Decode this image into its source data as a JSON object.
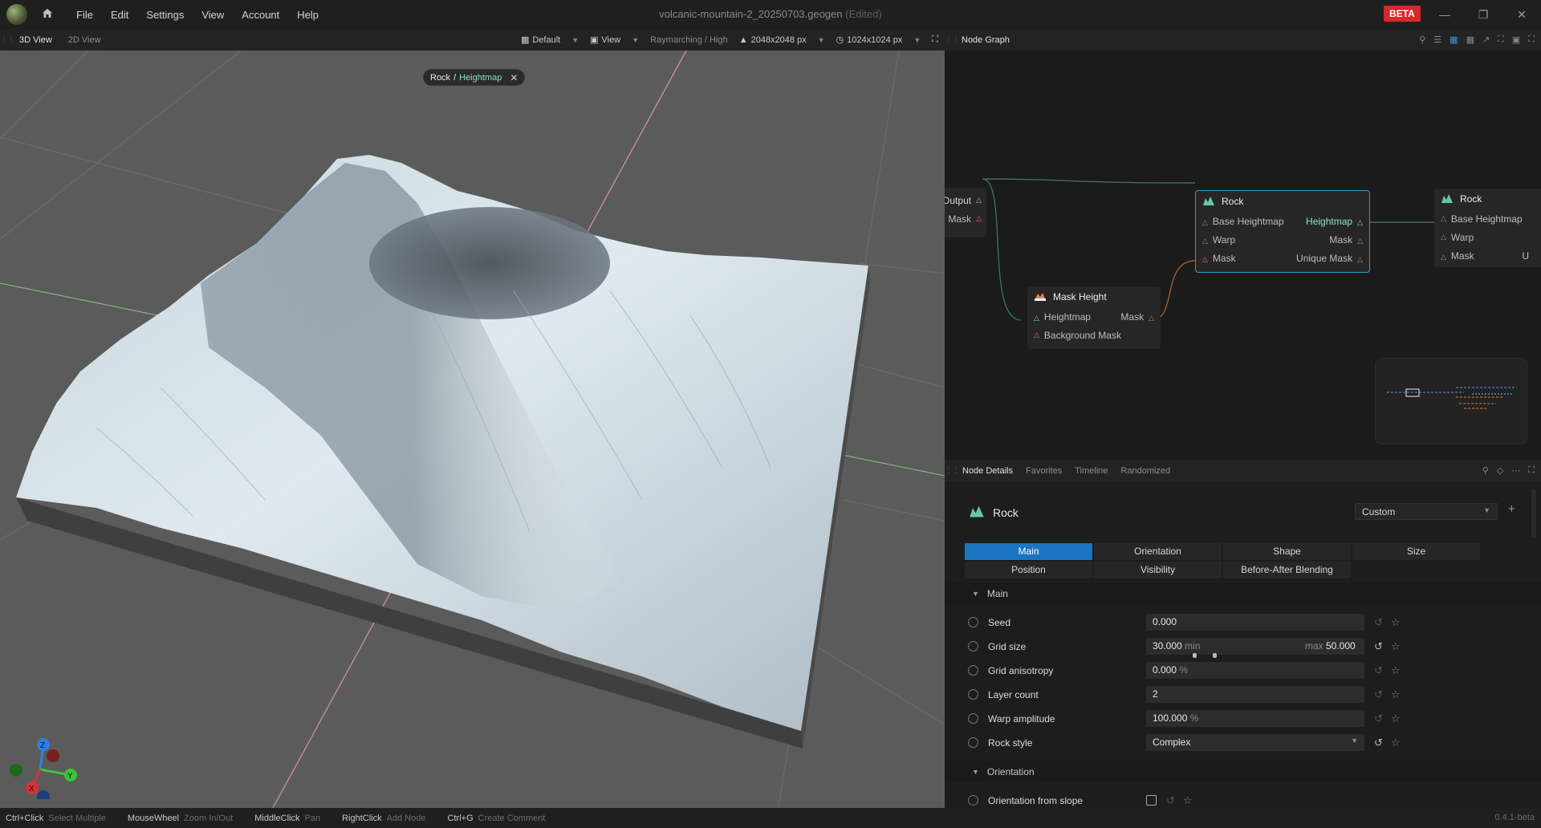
{
  "app": {
    "title": "volcanic-mountain-2_20250703.geogen",
    "edited": "(Edited)",
    "beta_badge": "BETA",
    "menu": [
      "File",
      "Edit",
      "Settings",
      "View",
      "Account",
      "Help"
    ]
  },
  "viewport": {
    "tabs": [
      "3D View",
      "2D View"
    ],
    "toolbar": {
      "preset": "Default",
      "view": "View",
      "render_mode": "Raymarching / High",
      "resolution": "2048x2048 px",
      "texture_res": "1024x1024 px"
    },
    "breadcrumb": {
      "node": "Rock",
      "sep": "/",
      "output": "Heightmap"
    },
    "axes": {
      "z": "Z",
      "y": "Y",
      "x": "X"
    }
  },
  "node_graph": {
    "tab": "Node Graph",
    "nodes": {
      "output_partial": {
        "ports": [
          "Output",
          "Mask"
        ]
      },
      "rock_main": {
        "title": "Rock",
        "inputs": [
          "Base Heightmap",
          "Warp",
          "Mask"
        ],
        "outputs": [
          "Heightmap",
          "Mask",
          "Unique Mask"
        ]
      },
      "mask_height": {
        "title": "Mask Height",
        "inputs": [
          "Heightmap",
          "Background Mask"
        ],
        "outputs": [
          "Mask"
        ]
      },
      "rock_right": {
        "title": "Rock",
        "inputs": [
          "Base Heightmap",
          "Warp",
          "Mask"
        ],
        "cut_output": "U"
      }
    }
  },
  "details": {
    "tabs": [
      "Node Details",
      "Favorites",
      "Timeline",
      "Randomized"
    ],
    "node_name": "Rock",
    "preset": "Custom",
    "param_tabs": [
      "Main",
      "Orientation",
      "Shape",
      "Size",
      "Position",
      "Visibility",
      "Before-After Blending"
    ],
    "active_param_tab": "Main",
    "sections": {
      "main": "Main",
      "orientation": "Orientation"
    },
    "params": {
      "seed": {
        "label": "Seed",
        "value": "0.000"
      },
      "grid_size": {
        "label": "Grid size",
        "min_label": "min",
        "min": "30.000",
        "max_label": "max",
        "max": "50.000"
      },
      "grid_anisotropy": {
        "label": "Grid anisotropy",
        "value": "0.000",
        "unit": "%"
      },
      "layer_count": {
        "label": "Layer count",
        "value": "2"
      },
      "warp_amplitude": {
        "label": "Warp amplitude",
        "value": "100.000",
        "unit": "%",
        "fill_fraction": 0.57
      },
      "rock_style": {
        "label": "Rock style",
        "value": "Complex"
      },
      "orientation_from_slope": {
        "label": "Orientation from slope",
        "checked": false
      }
    }
  },
  "status": {
    "hints": [
      {
        "key": "Ctrl+Click",
        "desc": "Select Multiple"
      },
      {
        "key": "MouseWheel",
        "desc": "Zoom In/Out"
      },
      {
        "key": "MiddleClick",
        "desc": "Pan"
      },
      {
        "key": "RightClick",
        "desc": "Add Node"
      },
      {
        "key": "Ctrl+G",
        "desc": "Create Comment"
      }
    ],
    "version": "0.4.1-beta"
  }
}
